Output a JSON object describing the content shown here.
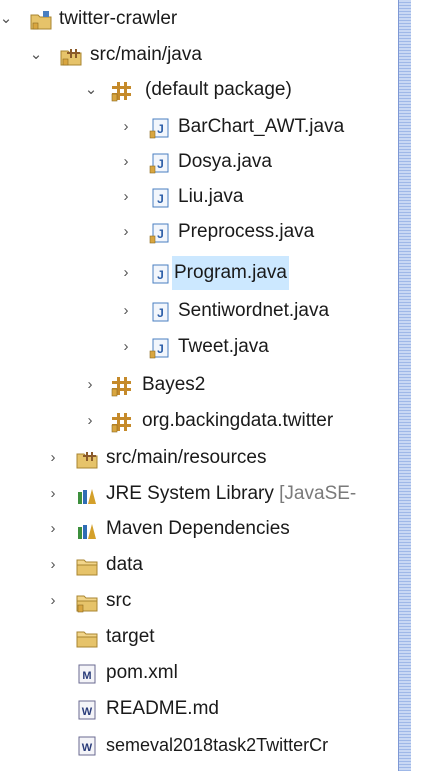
{
  "project": {
    "name": "twitter-crawler",
    "children": [
      {
        "label": "src/main/java"
      },
      {
        "label": "(default package)"
      },
      {
        "label": "BarChart_AWT.java"
      },
      {
        "label": "Dosya.java"
      },
      {
        "label": "Liu.java"
      },
      {
        "label": "Preprocess.java"
      },
      {
        "label": "Program.java"
      },
      {
        "label": "Sentiwordnet.java"
      },
      {
        "label": "Tweet.java"
      },
      {
        "label": "Bayes2"
      },
      {
        "label": "org.backingdata.twitter"
      },
      {
        "label": "src/main/resources"
      },
      {
        "label": "JRE System Library",
        "suffix": "[JavaSE-"
      },
      {
        "label": "Maven Dependencies"
      },
      {
        "label": "data"
      },
      {
        "label": "src"
      },
      {
        "label": "target"
      },
      {
        "label": "pom.xml"
      },
      {
        "label": "README.md"
      },
      {
        "label": "semeval2018task2TwitterCr"
      }
    ]
  },
  "colors": {
    "selection": "#cce8ff",
    "package": "#c7a34a",
    "folder": "#e6c36a",
    "java": "#4a7fc1",
    "library": "#3d8f3d"
  }
}
